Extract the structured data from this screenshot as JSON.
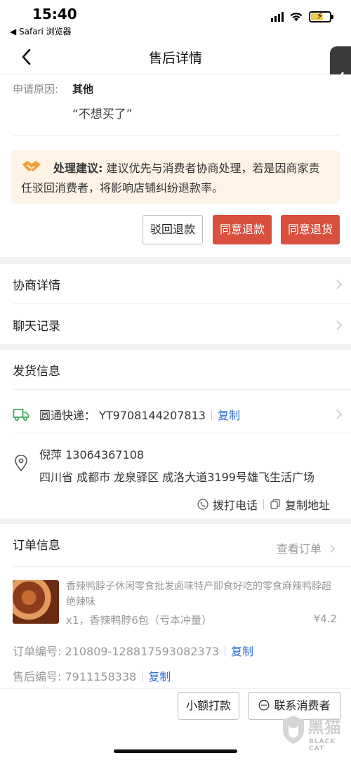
{
  "status_bar": {
    "time": "15:40",
    "back_app": "◀ Safari 浏览器"
  },
  "nav": {
    "title": "售后详情"
  },
  "refund": {
    "reason_label": "申请原因:",
    "reason_value": "其他",
    "reason_quote": "“不想买了”",
    "suggestion_title": "处理建议:",
    "suggestion_text": "建议优先与消费者协商处理，若是因商家责任驳回消费者，将影响店铺纠纷退款率。",
    "buttons": {
      "reject": "驳回退款",
      "agree_refund": "同意退款",
      "agree_return": "同意退货"
    }
  },
  "links": [
    {
      "label": "协商详情"
    },
    {
      "label": "聊天记录"
    }
  ],
  "shipping": {
    "title": "发货信息",
    "express": "圆通快递：  YT9708144207813",
    "copy": "复制",
    "name_phone": "倪萍  13064367108",
    "address": "四川省 成都市 龙泉驿区 成洛大道3199号雄飞生活广场",
    "call": "拨打电话",
    "copy_address": "复制地址"
  },
  "order": {
    "title": "订单信息",
    "view_order": "查看订单",
    "product_title": "香辣鸭脖子休闲零食批发卤味特产即食好吃的零食麻辣鸭脖超绝辣味",
    "product_spec": "x1，香辣鸭脖6包（亏本冲量）",
    "product_price": "¥4.2",
    "order_no_label": "订单编号:",
    "order_no": "210809-128817593082373",
    "after_sale_label": "售后编号:",
    "after_sale_no": "7911158338",
    "copy": "复制"
  },
  "bottom": {
    "small_pay": "小额打款",
    "contact": "联系消费者"
  },
  "watermark": {
    "cn": "黑猫",
    "en": "BLACK CAT"
  },
  "colors": {
    "accent_red": "#d9503f",
    "link_blue": "#2f6fd8",
    "suggest_bg": "#fdf3e6"
  }
}
